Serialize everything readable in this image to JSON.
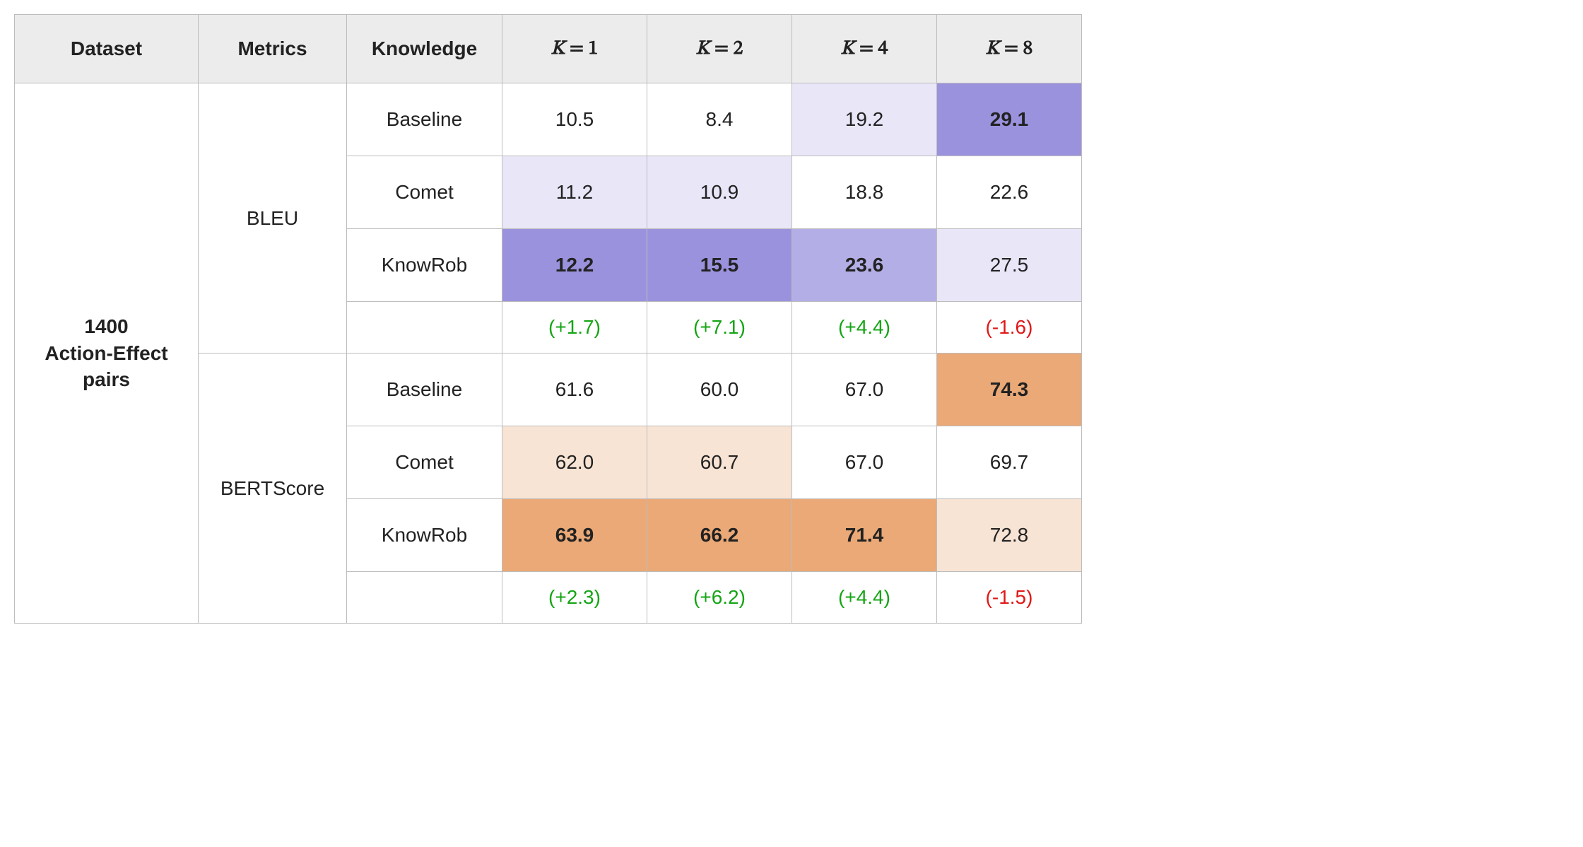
{
  "headers": {
    "dataset": "Dataset",
    "metrics": "Metrics",
    "knowledge": "Knowledge",
    "k1_var": "K",
    "k1_eq": " = 1",
    "k2_var": "K",
    "k2_eq": " = 2",
    "k4_var": "K",
    "k4_eq": " = 4",
    "k8_var": "K",
    "k8_eq": " = 8"
  },
  "dataset_label_line1": "1400",
  "dataset_label_line2": "Action-Effect",
  "dataset_label_line3": "pairs",
  "metrics": {
    "bleu": "BLEU",
    "bert": "BERTScore"
  },
  "knowledge": {
    "baseline": "Baseline",
    "comet": "Comet",
    "knowrob": "KnowRob"
  },
  "bleu": {
    "baseline": {
      "k1": "10.5",
      "k2": "8.4",
      "k4": "19.2",
      "k8": "29.1"
    },
    "comet": {
      "k1": "11.2",
      "k2": "10.9",
      "k4": "18.8",
      "k8": "22.6"
    },
    "knowrob": {
      "k1": "12.2",
      "k2": "15.5",
      "k4": "23.6",
      "k8": "27.5"
    },
    "delta": {
      "k1": "(+1.7)",
      "k2": "(+7.1)",
      "k4": "(+4.4)",
      "k8": "(-1.6)"
    }
  },
  "bert": {
    "baseline": {
      "k1": "61.6",
      "k2": "60.0",
      "k4": "67.0",
      "k8": "74.3"
    },
    "comet": {
      "k1": "62.0",
      "k2": "60.7",
      "k4": "67.0",
      "k8": "69.7"
    },
    "knowrob": {
      "k1": "63.9",
      "k2": "66.2",
      "k4": "71.4",
      "k8": "72.8"
    },
    "delta": {
      "k1": "(+2.3)",
      "k2": "(+6.2)",
      "k4": "(+4.4)",
      "k8": "(-1.5)"
    }
  },
  "colors": {
    "purple_light": "#e9e6f8",
    "purple_mid": "#b4aee6",
    "purple_strong": "#9b92de",
    "orange_light": "#f8e4d4",
    "orange_mid": "#f0c3a0",
    "orange_strong": "#eaa977"
  },
  "chart_data": {
    "type": "table",
    "dataset": "1400 Action-Effect pairs",
    "k_values": [
      1,
      2,
      4,
      8
    ],
    "metrics": [
      {
        "name": "BLEU",
        "rows": [
          {
            "knowledge": "Baseline",
            "values": [
              10.5,
              8.4,
              19.2,
              29.1
            ]
          },
          {
            "knowledge": "Comet",
            "values": [
              11.2,
              10.9,
              18.8,
              22.6
            ]
          },
          {
            "knowledge": "KnowRob",
            "values": [
              12.2,
              15.5,
              23.6,
              27.5
            ]
          }
        ],
        "delta_best_vs_baseline": [
          1.7,
          7.1,
          4.4,
          -1.6
        ]
      },
      {
        "name": "BERTScore",
        "rows": [
          {
            "knowledge": "Baseline",
            "values": [
              61.6,
              60.0,
              67.0,
              74.3
            ]
          },
          {
            "knowledge": "Comet",
            "values": [
              62.0,
              60.7,
              67.0,
              69.7
            ]
          },
          {
            "knowledge": "KnowRob",
            "values": [
              63.9,
              66.2,
              71.4,
              72.8
            ]
          }
        ],
        "delta_best_vs_baseline": [
          2.3,
          6.2,
          4.4,
          -1.5
        ]
      }
    ],
    "best_per_column_is_bold": true
  }
}
